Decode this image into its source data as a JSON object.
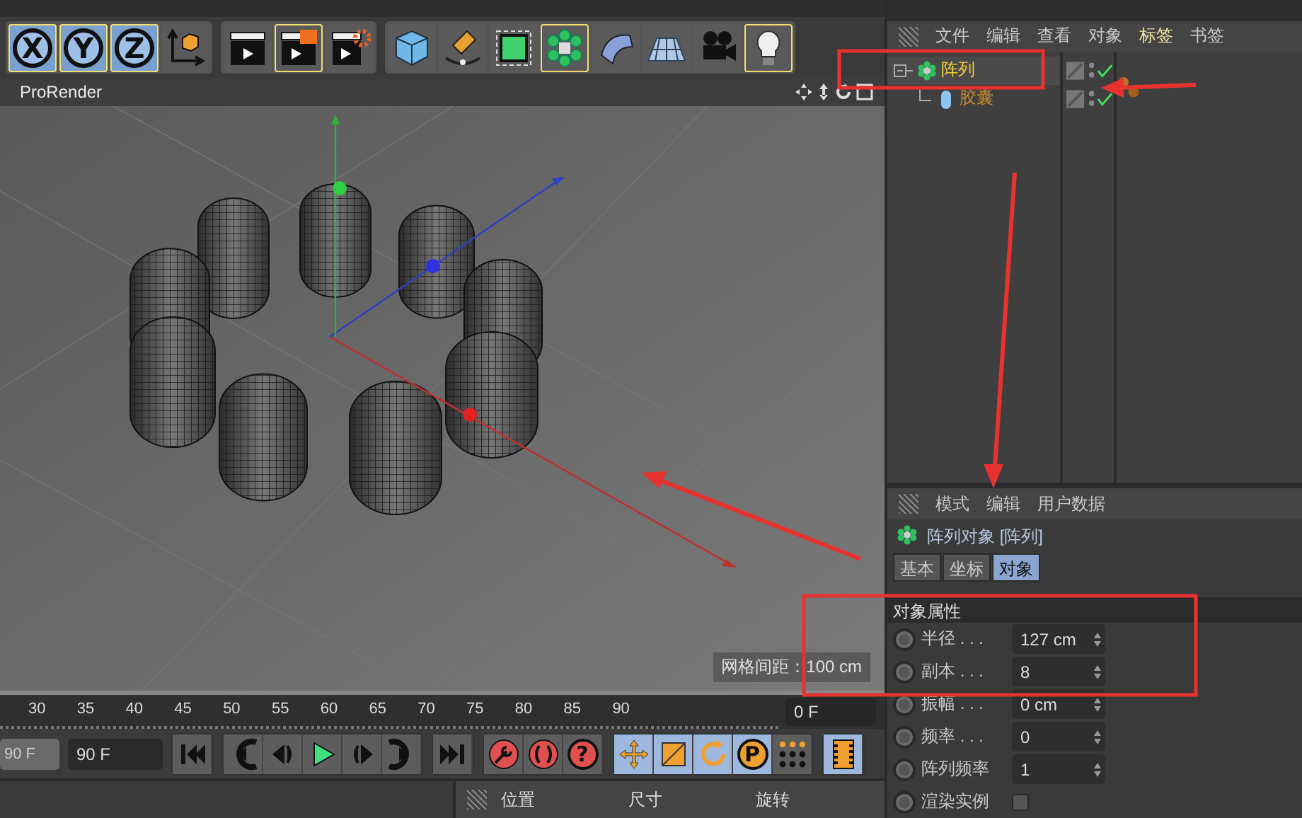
{
  "toolbar": {
    "groups": [
      [
        {
          "kind": "axis",
          "label": "X",
          "selected": true
        },
        {
          "kind": "axis",
          "label": "Y",
          "selected": true
        },
        {
          "kind": "axis",
          "label": "Z",
          "selected": true
        },
        {
          "kind": "coord",
          "selected": false
        }
      ],
      [
        {
          "kind": "render-view",
          "selected": false
        },
        {
          "kind": "render-picture",
          "selected": true
        },
        {
          "kind": "render-settings",
          "selected": false
        }
      ],
      [
        {
          "kind": "cube",
          "selected": false
        },
        {
          "kind": "pen",
          "selected": false
        },
        {
          "kind": "subdiv",
          "selected": false
        },
        {
          "kind": "array",
          "selected": true
        },
        {
          "kind": "deformer",
          "selected": false
        },
        {
          "kind": "floor",
          "selected": false
        },
        {
          "kind": "camera",
          "selected": false
        },
        {
          "kind": "light",
          "selected": true
        }
      ]
    ]
  },
  "viewport": {
    "title": "ProRender",
    "grid_spacing": "网格间距：100 cm"
  },
  "timeline": {
    "ticks": [
      "30",
      "35",
      "40",
      "45",
      "50",
      "55",
      "60",
      "65",
      "70",
      "75",
      "80",
      "85",
      "90"
    ],
    "current_frame": "0 F"
  },
  "transport": {
    "end_button": "90 F",
    "end_field": "90 F",
    "groups": [
      [
        {
          "kind": "go-start",
          "selected": false
        }
      ],
      [
        {
          "kind": "prev-key",
          "selected": false
        },
        {
          "kind": "prev-frame",
          "selected": false
        },
        {
          "kind": "play",
          "selected": false
        },
        {
          "kind": "next-frame",
          "selected": false
        },
        {
          "kind": "next-key",
          "selected": false
        }
      ],
      [
        {
          "kind": "go-end",
          "selected": false
        }
      ],
      [
        {
          "kind": "record",
          "selected": false
        },
        {
          "kind": "autokey",
          "selected": false
        },
        {
          "kind": "help",
          "label": "?",
          "selected": false
        }
      ],
      [
        {
          "kind": "move",
          "selected": true
        },
        {
          "kind": "scale",
          "selected": true
        },
        {
          "kind": "rotate",
          "selected": true
        },
        {
          "kind": "param",
          "label": "P",
          "selected": true
        },
        {
          "kind": "dots",
          "selected": false
        }
      ],
      [
        {
          "kind": "film",
          "selected": true
        }
      ]
    ]
  },
  "coordinates": {
    "columns": [
      "位置",
      "尺寸",
      "旋转"
    ]
  },
  "object_manager": {
    "menu": [
      {
        "label": "文件",
        "selected": false
      },
      {
        "label": "编辑",
        "selected": false
      },
      {
        "label": "查看",
        "selected": false
      },
      {
        "label": "对象",
        "selected": false
      },
      {
        "label": "标签",
        "selected": true
      },
      {
        "label": "书签",
        "selected": false
      }
    ],
    "objects": [
      {
        "name": "阵列",
        "kind": "array",
        "selected": true,
        "enabled": true,
        "expanded": true,
        "children": [
          {
            "name": "胶囊",
            "kind": "capsule",
            "selected": false,
            "enabled": true,
            "material": true
          }
        ]
      }
    ]
  },
  "attributes": {
    "menu": [
      "模式",
      "编辑",
      "用户数据"
    ],
    "title": "阵列对象 [阵列]",
    "tabs": [
      {
        "label": "基本",
        "selected": false
      },
      {
        "label": "坐标",
        "selected": false
      },
      {
        "label": "对象",
        "selected": true
      }
    ],
    "section": "对象属性",
    "params": [
      {
        "kind": "number",
        "label": "半径 . . .",
        "value": "127 cm"
      },
      {
        "kind": "number",
        "label": "副本 . . .",
        "value": "8"
      },
      {
        "kind": "number",
        "label": "振幅 . . .",
        "value": "0 cm"
      },
      {
        "kind": "number",
        "label": "频率 . . .",
        "value": "0"
      },
      {
        "kind": "number",
        "label": "阵列频率",
        "value": "1"
      },
      {
        "kind": "checkbox",
        "label": "渲染实例",
        "checked": false
      }
    ]
  },
  "annotations": [
    {
      "kind": "box"
    },
    {
      "kind": "box"
    },
    {
      "kind": "arrow"
    },
    {
      "kind": "arrow"
    },
    {
      "kind": "arrow"
    }
  ]
}
